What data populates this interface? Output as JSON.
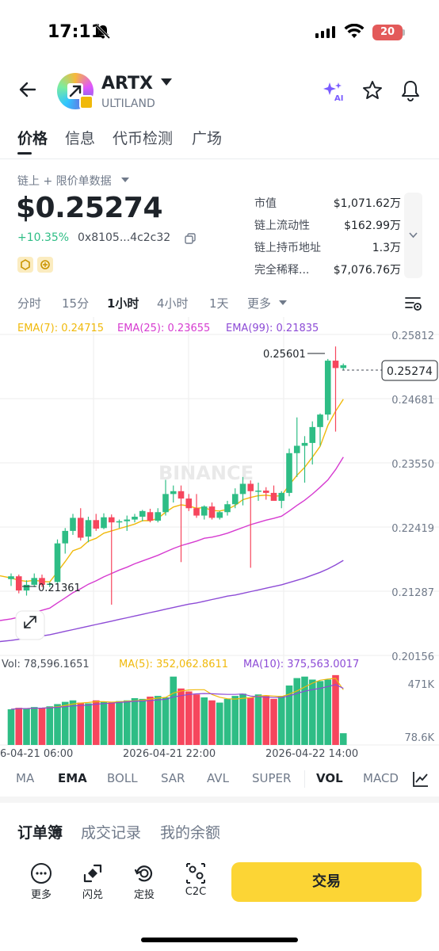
{
  "status_bar": {
    "time": "17:11",
    "battery": "20"
  },
  "header": {
    "symbol": "ARTX",
    "name": "ULTILAND",
    "icons": [
      "back-arrow-icon",
      "ai-sparkle-icon",
      "star-icon",
      "bell-icon"
    ]
  },
  "tabs": [
    {
      "label": "价格",
      "active": true
    },
    {
      "label": "信息"
    },
    {
      "label": "代币检测"
    },
    {
      "label": "广场"
    }
  ],
  "price_section": {
    "source_label": "链上 + 限价单数据",
    "price": "$0.25274",
    "change": "+10.35%",
    "address": "0x8105...4c2c32",
    "stats": [
      {
        "label": "市值",
        "value": "$1,071.62万"
      },
      {
        "label": "链上流动性",
        "value": "$162.99万"
      },
      {
        "label": "链上持币地址",
        "value": "1.3万"
      },
      {
        "label": "完全稀释...",
        "value": "$7,076.76万"
      }
    ]
  },
  "intervals": [
    "分时",
    "15分",
    "1小时",
    "4小时",
    "1天",
    "更多"
  ],
  "active_interval": "1小时",
  "chart": {
    "ema_labels": {
      "ema7": "EMA(7): 0.24715",
      "ema25": "EMA(25): 0.23655",
      "ema99": "EMA(99): 0.21835"
    },
    "price_axis": [
      "0.25812",
      "0.24681",
      "0.23550",
      "0.22419",
      "0.21287",
      "0.20156"
    ],
    "current_price_label": "0.25274",
    "high_label": "0.25601",
    "low_label": "0.21361",
    "watermark": "BINANCE",
    "vol_labels": {
      "vol": "Vol: 78,596.1651",
      "ma5": "MA(5): 352,062.8611",
      "ma10": "MA(10): 375,563.0017"
    },
    "vol_axis": [
      "471K",
      "78.6K"
    ],
    "time_axis": [
      "6-04-21 06:00",
      "2026-04-21 22:00",
      "2026-04-22 14:00"
    ]
  },
  "chart_data": {
    "type": "candlestick",
    "interval": "1小时",
    "ylim": [
      0.20156,
      0.25812
    ],
    "candles": [
      [
        0.215,
        0.216,
        0.2138,
        0.2155
      ],
      [
        0.2155,
        0.2158,
        0.2125,
        0.213
      ],
      [
        0.213,
        0.2148,
        0.2121,
        0.214
      ],
      [
        0.214,
        0.216,
        0.2136,
        0.2152
      ],
      [
        0.2152,
        0.2158,
        0.2136,
        0.214
      ],
      [
        0.214,
        0.2145,
        0.2136,
        0.2142
      ],
      [
        0.2145,
        0.222,
        0.2143,
        0.2213
      ],
      [
        0.2213,
        0.224,
        0.2195,
        0.2235
      ],
      [
        0.2235,
        0.2265,
        0.2228,
        0.2258
      ],
      [
        0.2258,
        0.2275,
        0.2218,
        0.2223
      ],
      [
        0.2225,
        0.226,
        0.2215,
        0.2254
      ],
      [
        0.2254,
        0.2265,
        0.2235,
        0.2239
      ],
      [
        0.224,
        0.2266,
        0.2238,
        0.2259
      ],
      [
        0.2259,
        0.2264,
        0.2105,
        0.225
      ],
      [
        0.225,
        0.2255,
        0.224,
        0.2252
      ],
      [
        0.2252,
        0.2262,
        0.2235,
        0.2255
      ],
      [
        0.2255,
        0.2265,
        0.225,
        0.226
      ],
      [
        0.226,
        0.2272,
        0.2252,
        0.227
      ],
      [
        0.2268,
        0.2274,
        0.225,
        0.2253
      ],
      [
        0.2253,
        0.2275,
        0.225,
        0.2268
      ],
      [
        0.2268,
        0.2325,
        0.2262,
        0.23
      ],
      [
        0.23,
        0.2315,
        0.2285,
        0.2305
      ],
      [
        0.2305,
        0.2315,
        0.218,
        0.2292
      ],
      [
        0.2292,
        0.23,
        0.227,
        0.2275
      ],
      [
        0.2275,
        0.23,
        0.2258,
        0.2262
      ],
      [
        0.2262,
        0.228,
        0.2255,
        0.2278
      ],
      [
        0.2278,
        0.2285,
        0.2255,
        0.2258
      ],
      [
        0.2258,
        0.227,
        0.2255,
        0.2268
      ],
      [
        0.2268,
        0.2288,
        0.2262,
        0.2282
      ],
      [
        0.2282,
        0.231,
        0.2275,
        0.23
      ],
      [
        0.23,
        0.233,
        0.228,
        0.2318
      ],
      [
        0.2318,
        0.2324,
        0.217,
        0.2305
      ],
      [
        0.2305,
        0.232,
        0.2288,
        0.2306
      ],
      [
        0.2306,
        0.2312,
        0.229,
        0.2302
      ],
      [
        0.2302,
        0.2315,
        0.229,
        0.2288
      ],
      [
        0.2288,
        0.2305,
        0.2275,
        0.2302
      ],
      [
        0.2302,
        0.238,
        0.2296,
        0.2372
      ],
      [
        0.2372,
        0.2435,
        0.233,
        0.2385
      ],
      [
        0.2385,
        0.2402,
        0.232,
        0.239
      ],
      [
        0.239,
        0.2428,
        0.2352,
        0.2418
      ],
      [
        0.2418,
        0.2442,
        0.2385,
        0.244
      ],
      [
        0.244,
        0.2538,
        0.243,
        0.2535
      ],
      [
        0.2535,
        0.256,
        0.241,
        0.2522
      ],
      [
        0.2522,
        0.253,
        0.2518,
        0.2527
      ]
    ],
    "ema7": [
      0.2152,
      0.2148,
      0.2146,
      0.2148,
      0.2146,
      0.2145,
      0.2163,
      0.2181,
      0.22,
      0.2205,
      0.2217,
      0.2222,
      0.2231,
      0.2235,
      0.2239,
      0.2243,
      0.2247,
      0.2253,
      0.2253,
      0.2257,
      0.2268,
      0.2277,
      0.2281,
      0.2279,
      0.2275,
      0.2276,
      0.2271,
      0.227,
      0.2273,
      0.228,
      0.229,
      0.2294,
      0.2297,
      0.2298,
      0.2296,
      0.2297,
      0.2316,
      0.2333,
      0.2347,
      0.2365,
      0.2384,
      0.2421,
      0.2446,
      0.2467
    ],
    "ema25": [
      0.208,
      0.2083,
      0.2087,
      0.2091,
      0.2095,
      0.2099,
      0.2108,
      0.2117,
      0.2126,
      0.2133,
      0.2141,
      0.2147,
      0.2154,
      0.216,
      0.2166,
      0.2171,
      0.2177,
      0.2182,
      0.2187,
      0.2192,
      0.2198,
      0.2204,
      0.2209,
      0.2213,
      0.2217,
      0.2222,
      0.2224,
      0.2227,
      0.2231,
      0.2236,
      0.2241,
      0.2246,
      0.225,
      0.2254,
      0.2257,
      0.2261,
      0.227,
      0.228,
      0.2289,
      0.23,
      0.2312,
      0.2325,
      0.2343,
      0.2365
    ],
    "ema99": [
      0.2042,
      0.2044,
      0.2046,
      0.2048,
      0.205,
      0.2052,
      0.2055,
      0.2058,
      0.2061,
      0.2064,
      0.2067,
      0.207,
      0.2073,
      0.2076,
      0.2079,
      0.2082,
      0.2085,
      0.2088,
      0.2091,
      0.2094,
      0.2097,
      0.21,
      0.2103,
      0.2106,
      0.2108,
      0.2111,
      0.2114,
      0.2117,
      0.212,
      0.2122,
      0.2125,
      0.2128,
      0.2131,
      0.2134,
      0.2137,
      0.214,
      0.2144,
      0.2148,
      0.2152,
      0.2157,
      0.2162,
      0.2168,
      0.2175,
      0.2183
    ],
    "volume": [
      240,
      250,
      245,
      255,
      250,
      260,
      275,
      290,
      300,
      285,
      280,
      300,
      290,
      285,
      295,
      300,
      315,
      310,
      325,
      330,
      320,
      460,
      380,
      360,
      340,
      320,
      300,
      285,
      310,
      330,
      345,
      320,
      340,
      330,
      310,
      330,
      400,
      450,
      460,
      440,
      430,
      440,
      470,
      79
    ],
    "volume_unit": "K"
  },
  "indicators": [
    "MA",
    "EMA",
    "BOLL",
    "SAR",
    "AVL",
    "SUPER",
    "VOL",
    "MACD"
  ],
  "bottom_tabs": [
    "订单簿",
    "成交记录",
    "我的余额"
  ],
  "actions": [
    {
      "label": "更多",
      "icon": "more-icon"
    },
    {
      "label": "闪兑",
      "icon": "swap-icon"
    },
    {
      "label": "定投",
      "icon": "recurring-icon"
    },
    {
      "label": "C2C",
      "icon": "c2c-icon"
    }
  ],
  "trade_button": "交易",
  "colors": {
    "up": "#2ebd85",
    "down": "#f6465d",
    "ema7": "#f0b90b",
    "ema25": "#d63bd0",
    "ema99": "#8d4bd6",
    "accent": "#fcd535"
  }
}
